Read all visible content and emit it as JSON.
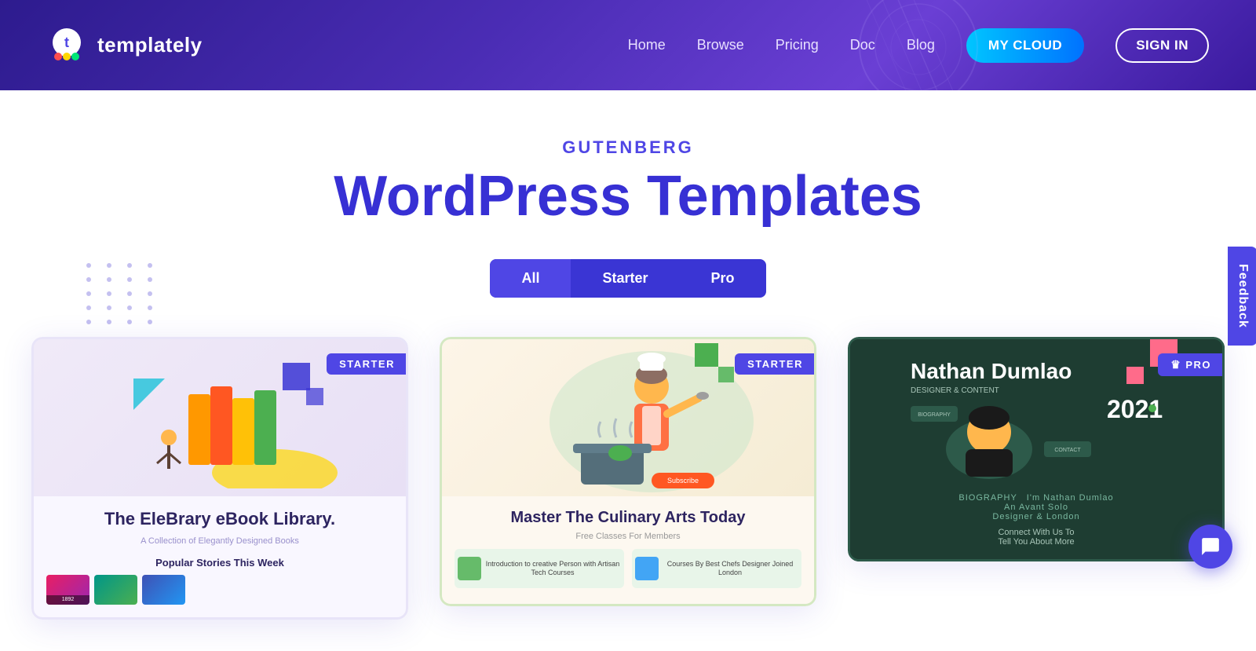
{
  "header": {
    "logo_text": "templately",
    "nav_items": [
      {
        "label": "Home",
        "id": "home"
      },
      {
        "label": "Browse",
        "id": "browse"
      },
      {
        "label": "Pricing",
        "id": "pricing"
      },
      {
        "label": "Doc",
        "id": "doc"
      },
      {
        "label": "Blog",
        "id": "blog"
      }
    ],
    "btn_my_cloud": "MY CLOUD",
    "btn_sign_in": "SIGN IN"
  },
  "hero": {
    "subtitle": "GUTENBERG",
    "title": "WordPress Templates",
    "filter_buttons": [
      {
        "label": "All",
        "id": "all",
        "active": true
      },
      {
        "label": "Starter",
        "id": "starter",
        "active": false
      },
      {
        "label": "Pro",
        "id": "pro",
        "active": false
      }
    ]
  },
  "cards": [
    {
      "id": "card-1",
      "badge": "STARTER",
      "title": "The EleBrary eBook Library.",
      "description": "A Collection of Elegantly Designed Books",
      "section_label": "Popular Stories This Week",
      "type": "starter"
    },
    {
      "id": "card-2",
      "badge": "STARTER",
      "title": "Master The Culinary Arts Today",
      "description": "Free Classes For Members",
      "section_label": "Courses By Best Chefs",
      "type": "starter"
    },
    {
      "id": "card-3",
      "badge": "PRO",
      "title": "Nathan Dumlao",
      "description": "DESIGNER & CONTENT",
      "year": "2021",
      "type": "pro"
    }
  ],
  "feedback": {
    "label": "Feedback"
  },
  "colors": {
    "primary": "#4f46e5",
    "accent_cyan": "#00c6ff",
    "header_bg": "#3a1a9e",
    "card_badge_starter": "#4f46e5",
    "card_badge_pro": "#4f46e5"
  }
}
